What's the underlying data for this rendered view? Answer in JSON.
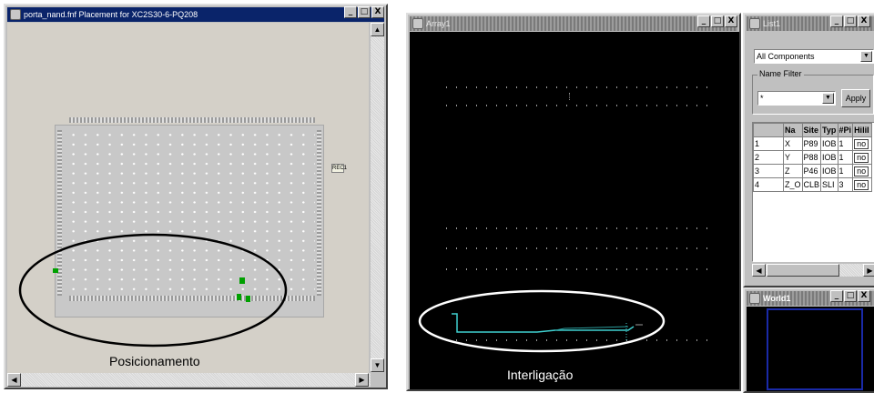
{
  "left_window": {
    "title": "porta_nand.fnf Placement for XC2S30-6-PQ208",
    "buttons": [
      "_",
      "□",
      "X"
    ],
    "rect_label": "REC1",
    "caption": "Posicionamento"
  },
  "array_window": {
    "title": "Array1",
    "buttons": [
      "_",
      "□",
      "X"
    ],
    "caption": "Interligação"
  },
  "list_window": {
    "title": "List1",
    "buttons": [
      "_",
      "□",
      "X"
    ],
    "filter_select": "All Components",
    "name_filter_label": "Name Filter",
    "name_filter_value": "*",
    "apply_label": "Apply",
    "table": {
      "headers": [
        "",
        "Na",
        "Site",
        "Typ",
        "#Pi",
        "HiliI"
      ],
      "rows": [
        [
          "1",
          "X",
          "P89",
          "IOB",
          "1",
          "no"
        ],
        [
          "2",
          "Y",
          "P88",
          "IOB",
          "1",
          "no"
        ],
        [
          "3",
          "Z",
          "P46",
          "IOB",
          "1",
          "no"
        ],
        [
          "4",
          "Z_O",
          "CLB",
          "SLI",
          "3",
          "no"
        ]
      ]
    }
  },
  "world_window": {
    "title": "World1",
    "buttons": [
      "_",
      "□",
      "X"
    ]
  },
  "colors": {
    "title_active": "#0a246a",
    "placed_block": "#00a000",
    "route_line": "#40d0d0",
    "ellipse": "#000000"
  }
}
